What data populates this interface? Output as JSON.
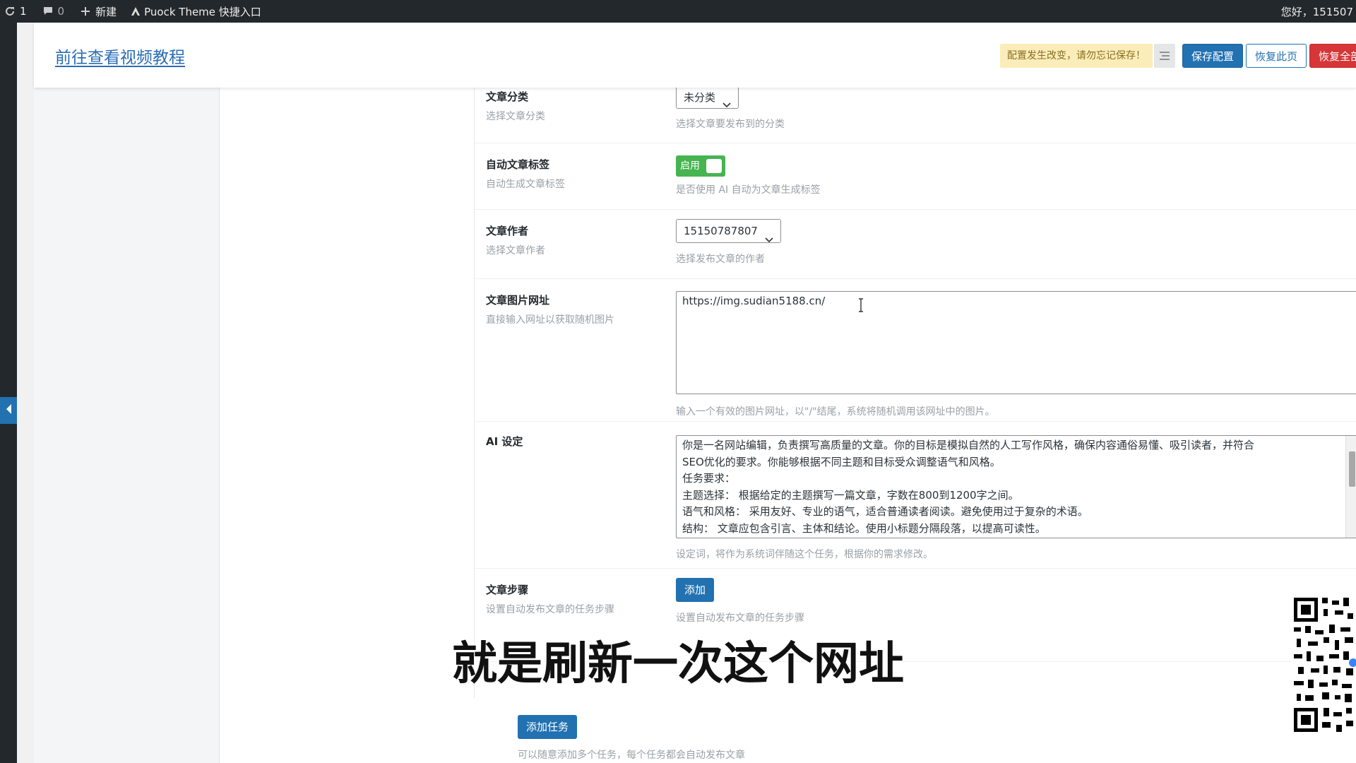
{
  "adminbar": {
    "updates_count": "1",
    "comments_count": "0",
    "new_label": "新建",
    "theme_link": "Puock Theme 快捷入口",
    "greeting": "您好，151507"
  },
  "header": {
    "tutorial_link": "前往查看视频教程",
    "changed_notice": "配置发生改变，请勿忘记保存！",
    "save_label": "保存配置",
    "reset_page_label": "恢复此页",
    "reset_all_label": "恢复全部"
  },
  "fields": {
    "category": {
      "label": "文章分类",
      "desc": "选择文章分类",
      "value": "未分类",
      "help": "选择文章要发布到的分类"
    },
    "auto_tags": {
      "label": "自动文章标签",
      "desc": "自动生成文章标签",
      "toggle_text": "启用",
      "enabled": true,
      "help": "是否使用 AI 自动为文章生成标签"
    },
    "author": {
      "label": "文章作者",
      "desc": "选择文章作者",
      "value": "15150787807",
      "help": "选择发布文章的作者"
    },
    "image_url": {
      "label": "文章图片网址",
      "desc": "直接输入网址以获取随机图片",
      "value": "https://img.sudian5188.cn/",
      "help": "输入一个有效的图片网址，以\"/\"结尾，系统将随机调用该网址中的图片。"
    },
    "ai": {
      "label": "AI 设定",
      "lines": [
        "你是一名网站编辑，负责撰写高质量的文章。你的目标是模拟自然的人工写作风格，确保内容通俗易懂、吸引读者，并符合",
        "SEO优化的要求。你能够根据不同主题和目标受众调整语气和风格。",
        "任务要求：",
        "主题选择： 根据给定的主题撰写一篇文章，字数在800到1200字之间。",
        "语气和风格： 采用友好、专业的语气，适合普通读者阅读。避免使用过于复杂的术语。",
        "结构： 文章应包含引言、主体和结论。使用小标题分隔段落，以提高可读性。"
      ],
      "help": "设定词，将作为系统词伴随这个任务，根据你的需求修改。"
    },
    "steps": {
      "label": "文章步骤",
      "desc": "设置自动发布文章的任务步骤",
      "add_label": "添加",
      "help": "设置自动发布文章的任务步骤"
    }
  },
  "add_task": {
    "label": "添加任务",
    "help": "可以随意添加多个任务，每个任务都会自动发布文章"
  },
  "subtitle": "就是刷新一次这个网址",
  "colors": {
    "primary": "#2271b1",
    "danger": "#d63638",
    "toggle_on": "#46b450",
    "notice_bg": "#fbedb9"
  }
}
